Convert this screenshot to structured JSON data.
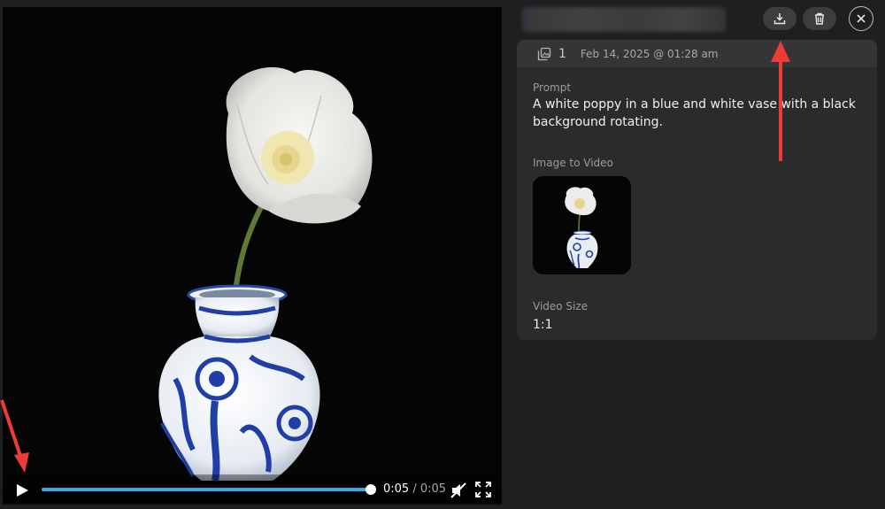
{
  "player": {
    "current_time": "0:05",
    "separator": "/",
    "duration": "0:05",
    "progress": 1.0,
    "accent_color": "#3aa9de"
  },
  "toolbar": {
    "download_icon": "download-icon",
    "delete_icon": "trash-icon",
    "close_icon": "close-icon"
  },
  "details": {
    "image_count": "1",
    "date": "Feb 14, 2025 @ 01:28 am",
    "prompt_label": "Prompt",
    "prompt_lines": [
      "A white poppy in a blue and white vase with a black",
      "background rotating."
    ],
    "image_to_video_label": "Image to Video",
    "video_size_label": "Video Size",
    "video_size_value": "1:1"
  },
  "annotations": {
    "arrow_color": "#ef3b36"
  }
}
